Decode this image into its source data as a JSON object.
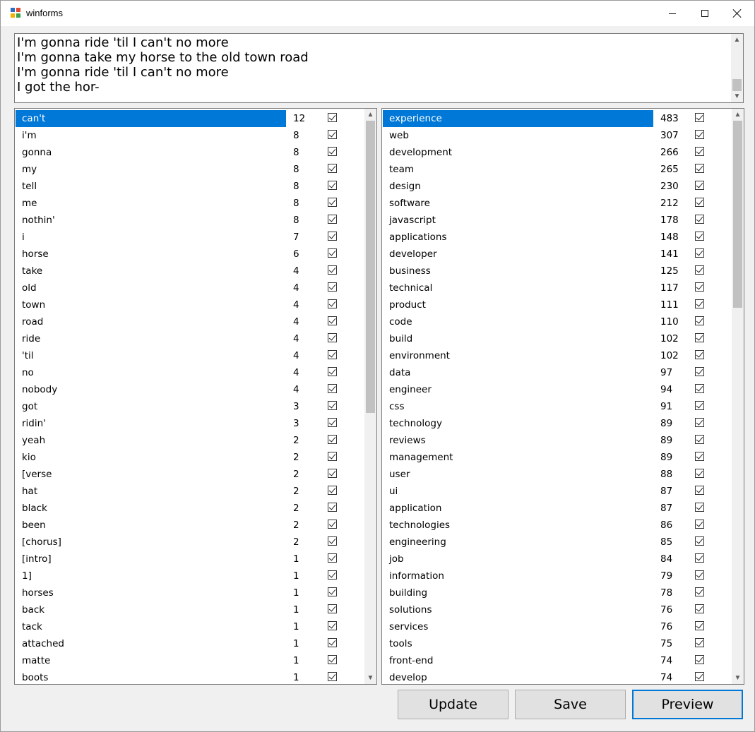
{
  "window": {
    "title": "winforms"
  },
  "lyrics": {
    "lines": [
      "I'm gonna ride 'til I can't no more",
      "I'm gonna take my horse to the old town road",
      "I'm gonna ride 'til I can't no more",
      "I got the hor-"
    ]
  },
  "left_list": {
    "selected_index": 0,
    "scroll_fraction": 0.0,
    "items": [
      {
        "word": "can't",
        "count": "12",
        "checked": true
      },
      {
        "word": "i'm",
        "count": "8",
        "checked": true
      },
      {
        "word": "gonna",
        "count": "8",
        "checked": true
      },
      {
        "word": "my",
        "count": "8",
        "checked": true
      },
      {
        "word": "tell",
        "count": "8",
        "checked": true
      },
      {
        "word": "me",
        "count": "8",
        "checked": true
      },
      {
        "word": "nothin'",
        "count": "8",
        "checked": true
      },
      {
        "word": "i",
        "count": "7",
        "checked": true
      },
      {
        "word": "horse",
        "count": "6",
        "checked": true
      },
      {
        "word": "take",
        "count": "4",
        "checked": true
      },
      {
        "word": "old",
        "count": "4",
        "checked": true
      },
      {
        "word": "town",
        "count": "4",
        "checked": true
      },
      {
        "word": "road",
        "count": "4",
        "checked": true
      },
      {
        "word": "ride",
        "count": "4",
        "checked": true
      },
      {
        "word": "'til",
        "count": "4",
        "checked": true
      },
      {
        "word": "no",
        "count": "4",
        "checked": true
      },
      {
        "word": "nobody",
        "count": "4",
        "checked": true
      },
      {
        "word": "got",
        "count": "3",
        "checked": true
      },
      {
        "word": "ridin'",
        "count": "3",
        "checked": true
      },
      {
        "word": "yeah",
        "count": "2",
        "checked": true
      },
      {
        "word": "kio",
        "count": "2",
        "checked": true
      },
      {
        "word": "[verse",
        "count": "2",
        "checked": true
      },
      {
        "word": "hat",
        "count": "2",
        "checked": true
      },
      {
        "word": "black",
        "count": "2",
        "checked": true
      },
      {
        "word": "been",
        "count": "2",
        "checked": true
      },
      {
        "word": "[chorus]",
        "count": "2",
        "checked": true
      },
      {
        "word": "[intro]",
        "count": "1",
        "checked": true
      },
      {
        "word": "1]",
        "count": "1",
        "checked": true
      },
      {
        "word": "horses",
        "count": "1",
        "checked": true
      },
      {
        "word": "back",
        "count": "1",
        "checked": true
      },
      {
        "word": "tack",
        "count": "1",
        "checked": true
      },
      {
        "word": "attached",
        "count": "1",
        "checked": true
      },
      {
        "word": "matte",
        "count": "1",
        "checked": true
      },
      {
        "word": "boots",
        "count": "1",
        "checked": true
      }
    ]
  },
  "right_list": {
    "selected_index": 0,
    "scroll_fraction": 0.0,
    "items": [
      {
        "word": "experience",
        "count": "483",
        "checked": true
      },
      {
        "word": "web",
        "count": "307",
        "checked": true
      },
      {
        "word": "development",
        "count": "266",
        "checked": true
      },
      {
        "word": "team",
        "count": "265",
        "checked": true
      },
      {
        "word": "design",
        "count": "230",
        "checked": true
      },
      {
        "word": "software",
        "count": "212",
        "checked": true
      },
      {
        "word": "javascript",
        "count": "178",
        "checked": true
      },
      {
        "word": "applications",
        "count": "148",
        "checked": true
      },
      {
        "word": "developer",
        "count": "141",
        "checked": true
      },
      {
        "word": "business",
        "count": "125",
        "checked": true
      },
      {
        "word": "technical",
        "count": "117",
        "checked": true
      },
      {
        "word": "product",
        "count": "111",
        "checked": true
      },
      {
        "word": "code",
        "count": "110",
        "checked": true
      },
      {
        "word": "build",
        "count": "102",
        "checked": true
      },
      {
        "word": "environment",
        "count": "102",
        "checked": true
      },
      {
        "word": "data",
        "count": "97",
        "checked": true
      },
      {
        "word": "engineer",
        "count": "94",
        "checked": true
      },
      {
        "word": "css",
        "count": "91",
        "checked": true
      },
      {
        "word": "technology",
        "count": "89",
        "checked": true
      },
      {
        "word": "reviews",
        "count": "89",
        "checked": true
      },
      {
        "word": "management",
        "count": "89",
        "checked": true
      },
      {
        "word": "user",
        "count": "88",
        "checked": true
      },
      {
        "word": "ui",
        "count": "87",
        "checked": true
      },
      {
        "word": "application",
        "count": "87",
        "checked": true
      },
      {
        "word": "technologies",
        "count": "86",
        "checked": true
      },
      {
        "word": "engineering",
        "count": "85",
        "checked": true
      },
      {
        "word": "job",
        "count": "84",
        "checked": true
      },
      {
        "word": "information",
        "count": "79",
        "checked": true
      },
      {
        "word": "building",
        "count": "78",
        "checked": true
      },
      {
        "word": "solutions",
        "count": "76",
        "checked": true
      },
      {
        "word": "services",
        "count": "76",
        "checked": true
      },
      {
        "word": "tools",
        "count": "75",
        "checked": true
      },
      {
        "word": "front-end",
        "count": "74",
        "checked": true
      },
      {
        "word": "develop",
        "count": "74",
        "checked": true
      }
    ]
  },
  "buttons": {
    "update_label": "Update",
    "save_label": "Save",
    "preview_label": "Preview"
  },
  "colors": {
    "selection": "#0078d7",
    "focus_border": "#0078d7",
    "window_bg": "#f0f0f0"
  }
}
